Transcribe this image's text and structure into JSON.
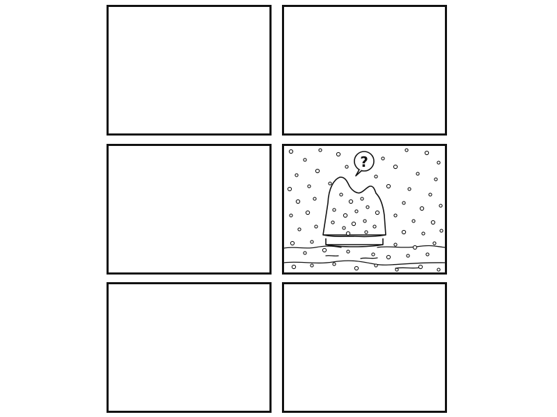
{
  "comic": {
    "panels": [
      {
        "id": "panel-1",
        "state": "blank"
      },
      {
        "id": "panel-2",
        "state": "blank"
      },
      {
        "id": "panel-3",
        "state": "blank"
      },
      {
        "id": "panel-4",
        "state": "illustrated",
        "scene": "snow-covered-doghouse"
      },
      {
        "id": "panel-5",
        "state": "blank"
      },
      {
        "id": "panel-6",
        "state": "blank"
      }
    ],
    "speech_bubble": {
      "text": "?"
    }
  },
  "colors": {
    "ink": "#111111",
    "paper": "#ffffff"
  }
}
